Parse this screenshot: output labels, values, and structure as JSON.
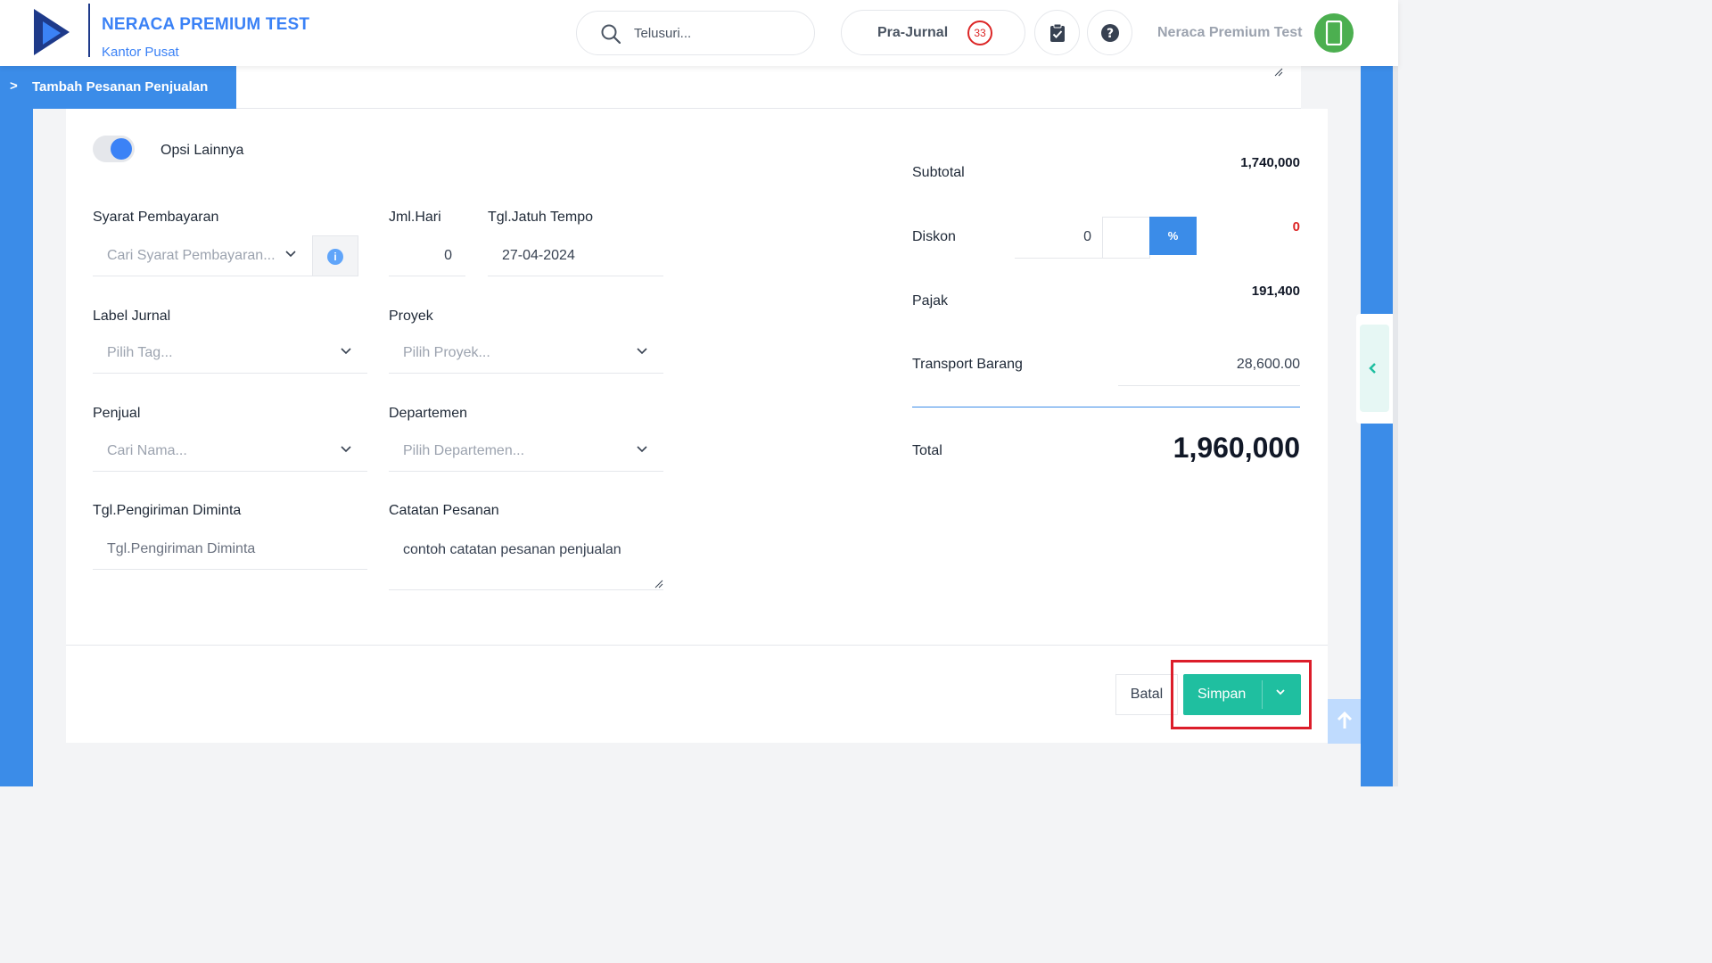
{
  "header": {
    "company_name": "NERACA PREMIUM TEST",
    "branch": "Kantor Pusat",
    "search_placeholder": "Telusuri...",
    "prajurnal_label": "Pra-Jurnal",
    "prajurnal_count": "33",
    "user_name": "Neraca Premium Test"
  },
  "breadcrumb": {
    "title": "Tambah Pesanan Penjualan"
  },
  "form": {
    "other_options_label": "Opsi Lainnya",
    "payment_terms": {
      "label": "Syarat Pembayaran",
      "placeholder": "Cari Syarat Pembayaran..."
    },
    "days": {
      "label": "Jml.Hari",
      "value": "0"
    },
    "due_date": {
      "label": "Tgl.Jatuh Tempo",
      "value": "27-04-2024"
    },
    "journal_label": {
      "label": "Label Jurnal",
      "placeholder": "Pilih Tag..."
    },
    "project": {
      "label": "Proyek",
      "placeholder": "Pilih Proyek..."
    },
    "salesperson": {
      "label": "Penjual",
      "placeholder": "Cari Nama..."
    },
    "department": {
      "label": "Departemen",
      "placeholder": "Pilih Departemen..."
    },
    "requested_ship_date": {
      "label": "Tgl.Pengiriman Diminta",
      "placeholder": "Tgl.Pengiriman Diminta"
    },
    "order_notes": {
      "label": "Catatan Pesanan",
      "value": "contoh catatan pesanan penjualan"
    }
  },
  "summary": {
    "subtotal_label": "Subtotal",
    "subtotal_value": "1,740,000",
    "discount_label": "Diskon",
    "discount_input": "0",
    "discount_mode": "%",
    "discount_value": "0",
    "tax_label": "Pajak",
    "tax_value": "191,400",
    "transport_label": "Transport Barang",
    "transport_value": "28,600.00",
    "total_label": "Total",
    "total_value": "1,960,000"
  },
  "footer": {
    "cancel_label": "Batal",
    "save_label": "Simpan"
  },
  "colors": {
    "primary_blue": "#3b8ce8",
    "save_green": "#1fbfa0",
    "highlight_red": "#dc1d2a",
    "badge_red": "#dc2626",
    "avatar_green": "#4caf50"
  }
}
